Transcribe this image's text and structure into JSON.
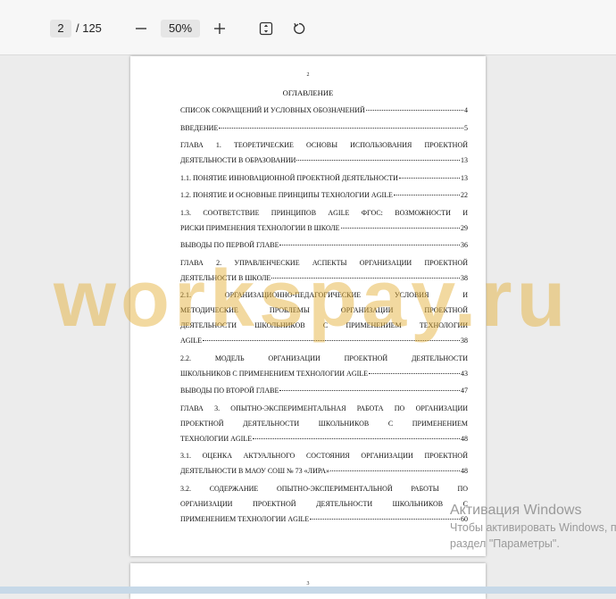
{
  "toolbar": {
    "current_page": "2",
    "total_pages": "/ 125",
    "zoom": "50%",
    "zoom_out_icon": "minus-icon",
    "zoom_in_icon": "plus-icon",
    "fit_icon": "fit-page-icon",
    "rotate_icon": "rotate-icon"
  },
  "page": {
    "number": "2",
    "heading": "ОГЛАВЛЕНИЕ",
    "toc": [
      {
        "lines": [
          "СПИСОК СОКРАЩЕНИЙ И УСЛОВНЫХ ОБОЗНАЧЕНИЙ"
        ],
        "page": "4"
      },
      {
        "lines": [
          "ВВЕДЕНИЕ"
        ],
        "page": "5"
      },
      {
        "lines": [
          "ГЛАВА 1. ТЕОРЕТИЧЕСКИЕ ОСНОВЫ ИСПОЛЬЗОВАНИЯ ПРОЕКТНОЙ",
          "ДЕЯТЕЛЬНОСТИ В ОБРАЗОВАНИИ"
        ],
        "page": "13"
      },
      {
        "lines": [
          "1.1.   ПОНЯТИЕ ИННОВАЦИОННОЙ ПРОЕКТНОЙ ДЕЯТЕЛЬНОСТИ"
        ],
        "page": "13"
      },
      {
        "lines": [
          "1.2.   ПОНЯТИЕ И ОСНОВНЫЕ ПРИНЦИПЫ ТЕХНОЛОГИИ AGILE"
        ],
        "page": "22"
      },
      {
        "lines": [
          "1.3.  СООТВЕТСТВИЕ ПРИНЦИПОВ AGILE ФГОС: ВОЗМОЖНОСТИ И",
          "РИСКИ ПРИМЕНЕНИЯ ТЕХНОЛОГИИ В ШКОЛЕ"
        ],
        "page": "29"
      },
      {
        "lines": [
          "ВЫВОДЫ ПО ПЕРВОЙ ГЛАВЕ"
        ],
        "page": "36"
      },
      {
        "lines": [
          "ГЛАВА 2. УПРАВЛЕНЧЕСКИЕ АСПЕКТЫ ОРГАНИЗАЦИИ ПРОЕКТНОЙ",
          "ДЕЯТЕЛЬНОСТИ В ШКОЛЕ"
        ],
        "page": "38"
      },
      {
        "lines": [
          "2.1. ОРГАНИЗАЦИОННО-ПЕДАГОГИЧЕСКИЕ УСЛОВИЯ И",
          "МЕТОДИЧЕСКИЕ ПРОБЛЕМЫ ОРГАНИЗАЦИИ ПРОЕКТНОЙ",
          "ДЕЯТЕЛЬНОСТИ ШКОЛЬНИКОВ С ПРИМЕНЕНИЕМ ТЕХНОЛОГИИ",
          "AGILE"
        ],
        "page": "38"
      },
      {
        "lines": [
          "2.2. МОДЕЛЬ ОРГАНИЗАЦИИ ПРОЕКТНОЙ ДЕЯТЕЛЬНОСТИ",
          "ШКОЛЬНИКОВ С ПРИМЕНЕНИЕМ ТЕХНОЛОГИИ AGILE"
        ],
        "page": "43"
      },
      {
        "lines": [
          "ВЫВОДЫ ПО ВТОРОЙ ГЛАВЕ"
        ],
        "page": "47"
      },
      {
        "lines": [
          "ГЛАВА 3. ОПЫТНО-ЭКСПЕРИМЕНТАЛЬНАЯ РАБОТА ПО ОРГАНИЗАЦИИ",
          "ПРОЕКТНОЙ ДЕЯТЕЛЬНОСТИ ШКОЛЬНИКОВ С ПРИМЕНЕНИЕМ",
          "ТЕХНОЛОГИИ AGILE"
        ],
        "page": "48"
      },
      {
        "lines": [
          "3.1. ОЦЕНКА АКТУАЛЬНОГО СОСТОЯНИЯ ОРГАНИЗАЦИИ ПРОЕКТНОЙ",
          "ДЕЯТЕЛЬНОСТИ В МАОУ СОШ № 73 «ЛИРА»"
        ],
        "page": "48"
      },
      {
        "lines": [
          "3.2. СОДЕРЖАНИЕ ОПЫТНО-ЭКСПЕРИМЕНТАЛЬНОЙ РАБОТЫ ПО",
          "ОРГАНИЗАЦИИ ПРОЕКТНОЙ ДЕЯТЕЛЬНОСТИ ШКОЛЬНИКОВ С",
          "ПРИМЕНЕНИЕМ ТЕХНОЛОГИИ AGILE"
        ],
        "page": "60"
      }
    ]
  },
  "next_page": {
    "number": "3"
  },
  "watermark": "workspay.ru",
  "activation": {
    "title": "Активация Windows",
    "line1": "Чтобы активировать Windows, перейдите в",
    "line2": "раздел \"Параметры\"."
  }
}
